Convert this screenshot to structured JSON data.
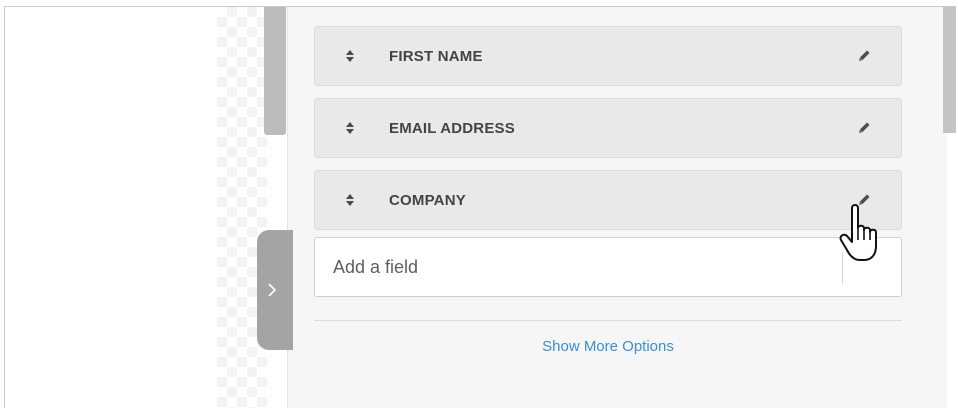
{
  "form_fields": {
    "rows": [
      {
        "label": "FIRST NAME",
        "drag_icon": "sort-arrows-icon",
        "edit_icon": "pencil-icon"
      },
      {
        "label": "EMAIL ADDRESS",
        "drag_icon": "sort-arrows-icon",
        "edit_icon": "pencil-icon"
      },
      {
        "label": "COMPANY",
        "drag_icon": "sort-arrows-icon",
        "edit_icon": "pencil-icon"
      }
    ],
    "add_field_placeholder": "Add a field",
    "show_more_label": "Show More Options"
  },
  "colors": {
    "row_background": "#e9e9e9",
    "panel_background": "#f6f6f6",
    "link": "#3a8fd6",
    "collapse_tab": "#a4a4a4"
  },
  "icons": {
    "collapse_tab": "chevron-right-icon",
    "cursor": "hand-pointer-cursor"
  }
}
